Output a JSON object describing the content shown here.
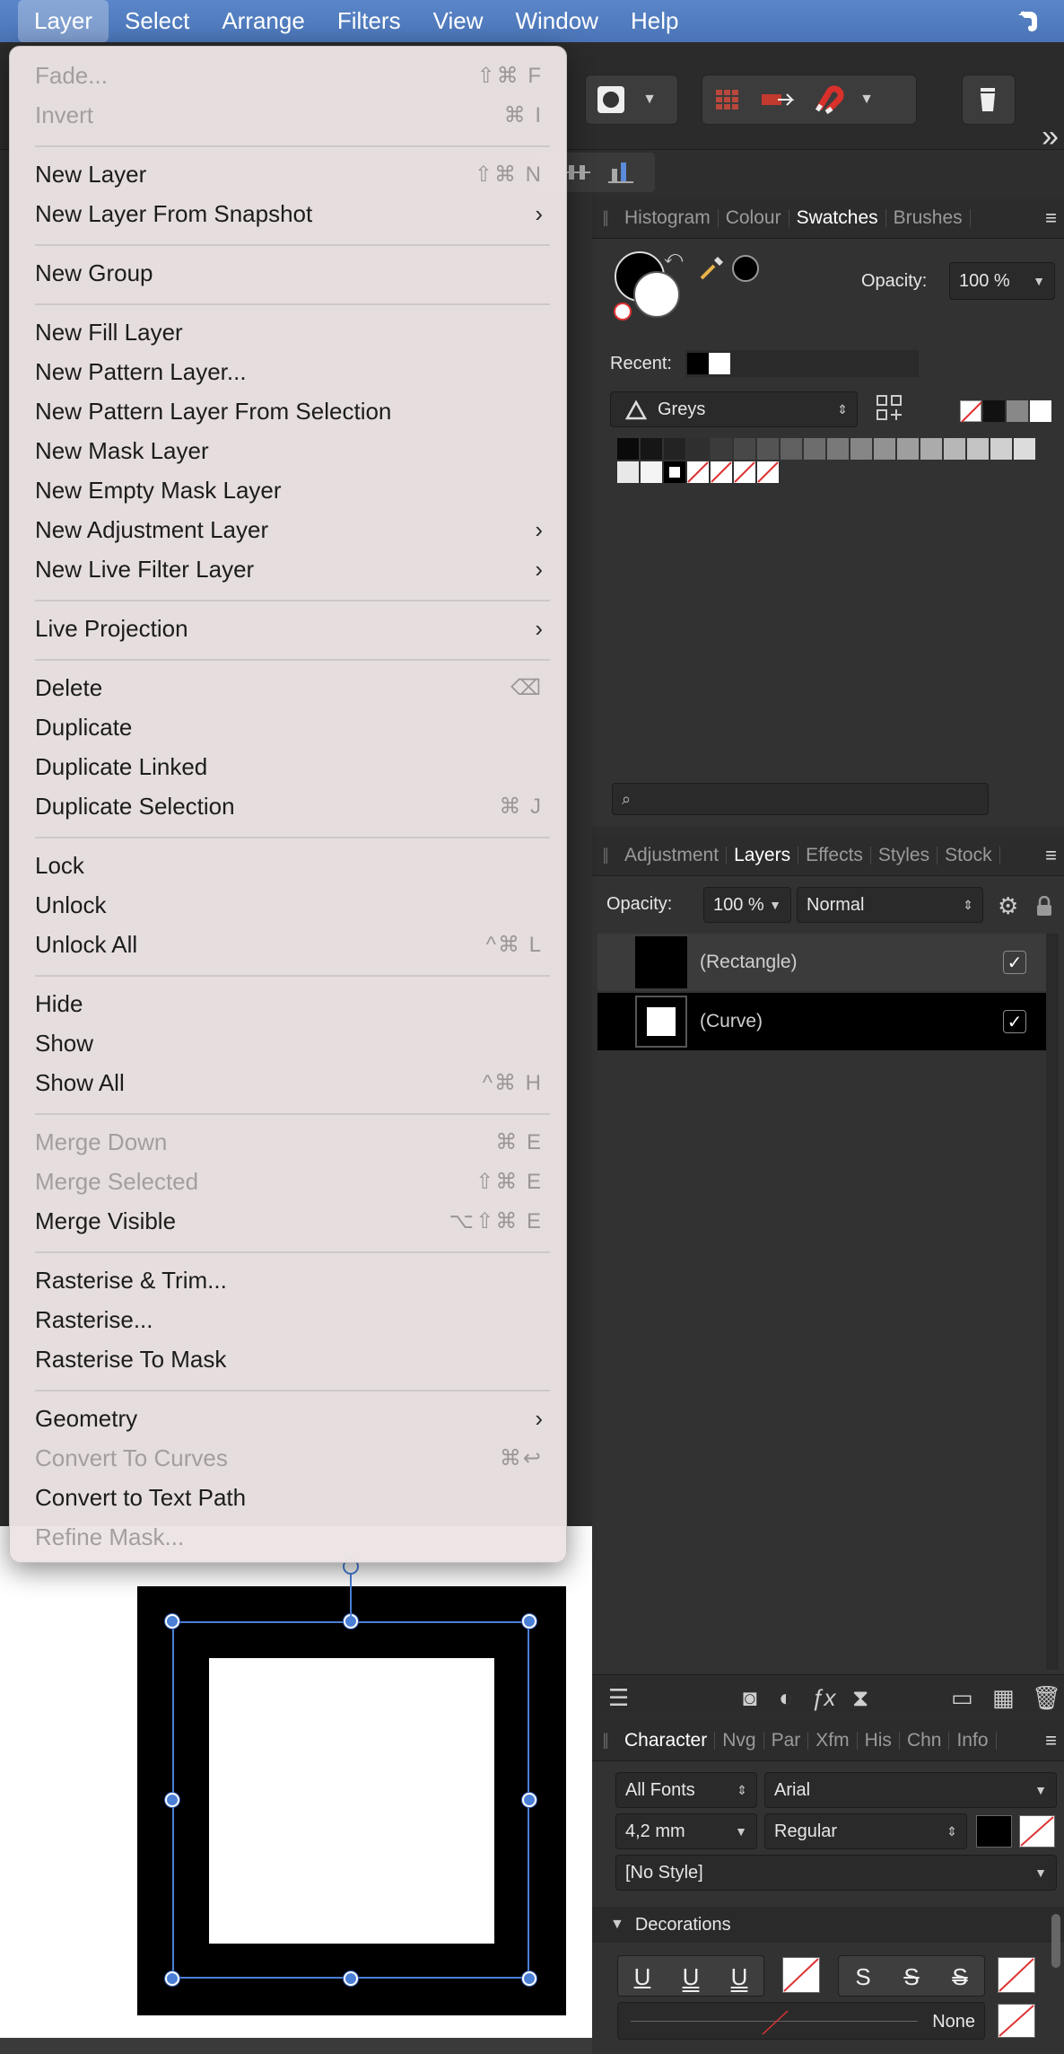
{
  "menubar": {
    "items": [
      {
        "label": "Layer",
        "active": true
      },
      {
        "label": "Select"
      },
      {
        "label": "Arrange"
      },
      {
        "label": "Filters"
      },
      {
        "label": "View"
      },
      {
        "label": "Window"
      },
      {
        "label": "Help"
      }
    ],
    "right_icon": "evernote-elephant-icon"
  },
  "layer_menu": {
    "sections": [
      [
        {
          "label": "Fade...",
          "shortcut": "⇧⌘ F",
          "disabled": true
        },
        {
          "label": "Invert",
          "shortcut": "⌘ I",
          "disabled": true
        }
      ],
      [
        {
          "label": "New Layer",
          "shortcut": "⇧⌘ N"
        },
        {
          "label": "New Layer From Snapshot",
          "submenu": true
        }
      ],
      [
        {
          "label": "New Group"
        }
      ],
      [
        {
          "label": "New Fill Layer"
        },
        {
          "label": "New Pattern Layer..."
        },
        {
          "label": "New Pattern Layer From Selection"
        },
        {
          "label": "New Mask Layer"
        },
        {
          "label": "New Empty Mask Layer"
        },
        {
          "label": "New Adjustment Layer",
          "submenu": true
        },
        {
          "label": "New Live Filter Layer",
          "submenu": true
        }
      ],
      [
        {
          "label": "Live Projection",
          "submenu": true
        }
      ],
      [
        {
          "label": "Delete",
          "shortcut": "⌫"
        },
        {
          "label": "Duplicate"
        },
        {
          "label": "Duplicate Linked"
        },
        {
          "label": "Duplicate Selection",
          "shortcut": "⌘ J"
        }
      ],
      [
        {
          "label": "Lock"
        },
        {
          "label": "Unlock"
        },
        {
          "label": "Unlock All",
          "shortcut": "^⌘ L"
        }
      ],
      [
        {
          "label": "Hide"
        },
        {
          "label": "Show"
        },
        {
          "label": "Show All",
          "shortcut": "^⌘ H"
        }
      ],
      [
        {
          "label": "Merge Down",
          "shortcut": "⌘ E",
          "disabled": true
        },
        {
          "label": "Merge Selected",
          "shortcut": "⇧⌘ E",
          "disabled": true
        },
        {
          "label": "Merge Visible",
          "shortcut": "⌥⇧⌘ E"
        }
      ],
      [
        {
          "label": "Rasterise & Trim..."
        },
        {
          "label": "Rasterise..."
        },
        {
          "label": "Rasterise To Mask"
        }
      ],
      [
        {
          "label": "Geometry",
          "submenu": true
        },
        {
          "label": "Convert To Curves",
          "shortcut": "⌘↩",
          "disabled": true
        },
        {
          "label": "Convert to Text Path"
        },
        {
          "label": "Refine Mask...",
          "disabled": true
        }
      ]
    ],
    "submenu_arrow": "›"
  },
  "swatches_panel": {
    "tabs": [
      {
        "label": "Histogram"
      },
      {
        "label": "Colour"
      },
      {
        "label": "Swatches",
        "active": true
      },
      {
        "label": "Brushes"
      }
    ],
    "opacity_label": "Opacity:",
    "opacity_value": "100 %",
    "recent_label": "Recent:",
    "palette_name": "Greys"
  },
  "layers_panel": {
    "tabs": [
      {
        "label": "Adjustment"
      },
      {
        "label": "Layers",
        "active": true
      },
      {
        "label": "Effects"
      },
      {
        "label": "Styles"
      },
      {
        "label": "Stock"
      }
    ],
    "opacity_label": "Opacity:",
    "opacity_value": "100 %",
    "blend_mode": "Normal",
    "layers": [
      {
        "name": "(Rectangle)",
        "visible_check": "✓",
        "selected": false
      },
      {
        "name": "(Curve)",
        "visible_check": "✓",
        "selected": true
      }
    ]
  },
  "character_panel": {
    "tabs": [
      {
        "label": "Character",
        "active": true
      },
      {
        "label": "Nvg"
      },
      {
        "label": "Par"
      },
      {
        "label": "Xfm"
      },
      {
        "label": "His"
      },
      {
        "label": "Chn"
      },
      {
        "label": "Info"
      }
    ],
    "font_collection": "All Fonts",
    "font_family": "Arial",
    "font_size": "4,2 mm",
    "font_style": "Regular",
    "paragraph_style": "[No Style]",
    "decorations_label": "Decorations",
    "underline_none_label": "None"
  },
  "toolbar": {
    "overflow": "»"
  }
}
